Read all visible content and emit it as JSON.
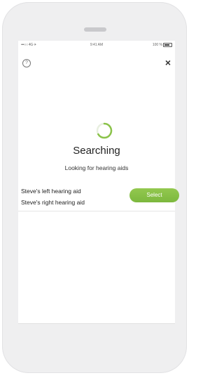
{
  "status_bar": {
    "signal": "•••○○ 4G ✈",
    "time": "9:41 AM",
    "battery": "100 %"
  },
  "header": {
    "help_icon": "question-circle-icon",
    "close_icon": "close-icon",
    "close_glyph": "×",
    "help_glyph": "?"
  },
  "search": {
    "title": "Searching",
    "subtitle": "Looking for hearing aids",
    "spinner_color": "#8bc34a"
  },
  "devices": {
    "left": "Steve's left hearing aid",
    "right": "Steve's right hearing aid",
    "select_label": "Select",
    "select_color": "#8bc34a"
  }
}
